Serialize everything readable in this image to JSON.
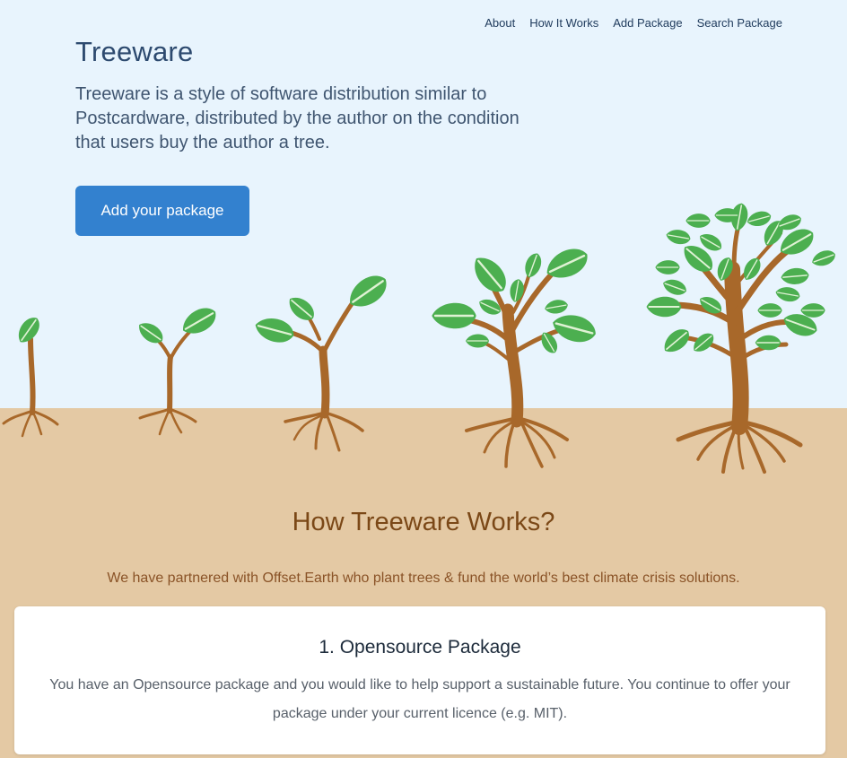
{
  "nav": {
    "items": [
      {
        "label": "About"
      },
      {
        "label": "How It Works"
      },
      {
        "label": "Add Package"
      },
      {
        "label": "Search Package"
      }
    ]
  },
  "hero": {
    "title": "Treeware",
    "description": "Treeware is a style of software distribution similar to Postcardware, distributed by the author on the condition that users buy the author a tree.",
    "cta_label": "Add your package"
  },
  "how": {
    "title": "How Treeware Works?",
    "subtitle": "We have partnered with Offset.Earth who plant trees & fund the world’s best climate crisis solutions."
  },
  "step_card": {
    "title": "1. Opensource Package",
    "text": "You have an Opensource package and you would like to help support a sustainable future. You continue to offer your package under your current licence (e.g. MIT)."
  },
  "colors": {
    "sky": "#e8f4fd",
    "soil": "#e4c9a4",
    "trunk": "#a8682a",
    "leaf": "#4caf50",
    "button": "#3381cf",
    "heading": "#7b4817"
  }
}
